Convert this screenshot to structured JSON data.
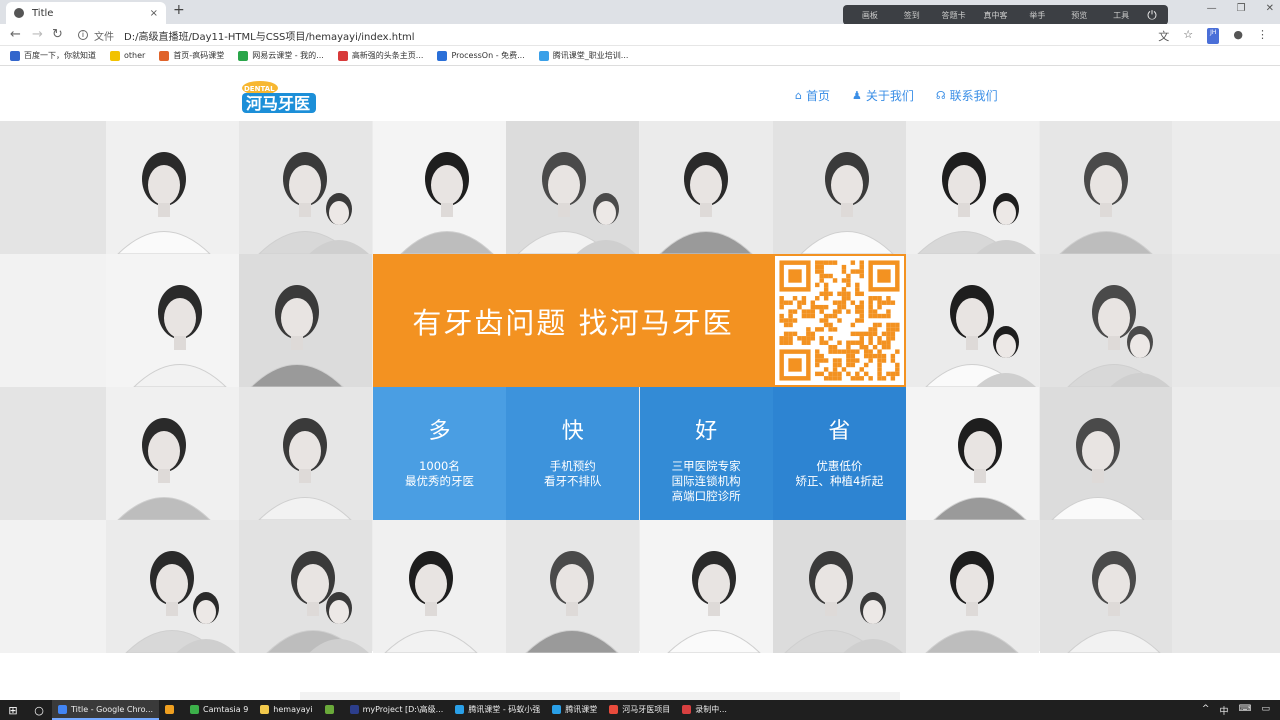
{
  "browser": {
    "tab_title": "Title",
    "tab_close": "×",
    "new_tab": "+",
    "address_label": "文件",
    "url": "D:/高级直播班/Day11-HTML与CSS项目/hemayayi/index.html",
    "window_controls": [
      "—",
      "❐",
      "✕"
    ]
  },
  "recorder_toolbar": [
    "画板",
    "签到",
    "答题卡",
    "真中客",
    "举手",
    "预览",
    "工具"
  ],
  "bookmarks": [
    {
      "label": "百度一下，你就知道",
      "color": "#3366cc"
    },
    {
      "label": "other",
      "color": "#f2c200"
    },
    {
      "label": "首页-疯码课堂",
      "color": "#e0632a"
    },
    {
      "label": "网易云课堂 - 我的...",
      "color": "#2aa64a"
    },
    {
      "label": "高新强的头条主页...",
      "color": "#d83a3a"
    },
    {
      "label": "ProcessOn - 免费...",
      "color": "#2a6fd8"
    },
    {
      "label": "腾讯课堂_职业培训...",
      "color": "#3aa0e8"
    }
  ],
  "site": {
    "logo_text": "河马牙医",
    "nav": [
      {
        "label": "首页",
        "icon": "home-icon"
      },
      {
        "label": "关于我们",
        "icon": "user-icon"
      },
      {
        "label": "联系我们",
        "icon": "headset-icon"
      }
    ],
    "banner_text": "有牙齿问题 找河马牙医",
    "features": [
      {
        "title": "多",
        "desc": "1000名\n最优秀的牙医",
        "color": "#4a9ee3"
      },
      {
        "title": "快",
        "desc": "手机预约\n看牙不排队",
        "color": "#3d93dc"
      },
      {
        "title": "好",
        "desc": "三甲医院专家\n国际连锁机构\n高端口腔诊所",
        "color": "#338bd6"
      },
      {
        "title": "省",
        "desc": "优惠低价\n矫正、种植4折起",
        "color": "#2d84d2"
      }
    ],
    "accent_orange": "#f39221",
    "accent_blue": "#3a8ee6"
  },
  "taskbar": {
    "items": [
      {
        "label": "Title - Google Chro...",
        "color": "#4285f4",
        "active": true
      },
      {
        "label": "",
        "color": "#f0a020",
        "active": false
      },
      {
        "label": "Camtasia 9",
        "color": "#3cb04a",
        "active": false
      },
      {
        "label": "hemayayi",
        "color": "#f2c94c",
        "active": false
      },
      {
        "label": "",
        "color": "#6aaa3a",
        "active": false
      },
      {
        "label": "myProject [D:\\高级...",
        "color": "#2c3e8c",
        "active": false
      },
      {
        "label": "腾讯课堂 - 码蚁小强",
        "color": "#2aa0e8",
        "active": false
      },
      {
        "label": "腾讯课堂",
        "color": "#2aa0e8",
        "active": false
      },
      {
        "label": "河马牙医项目",
        "color": "#e94b3c",
        "active": false
      },
      {
        "label": "录制中...",
        "color": "#d84040",
        "active": false
      }
    ],
    "tray": [
      "^",
      "中",
      "⌨",
      "▭"
    ]
  }
}
